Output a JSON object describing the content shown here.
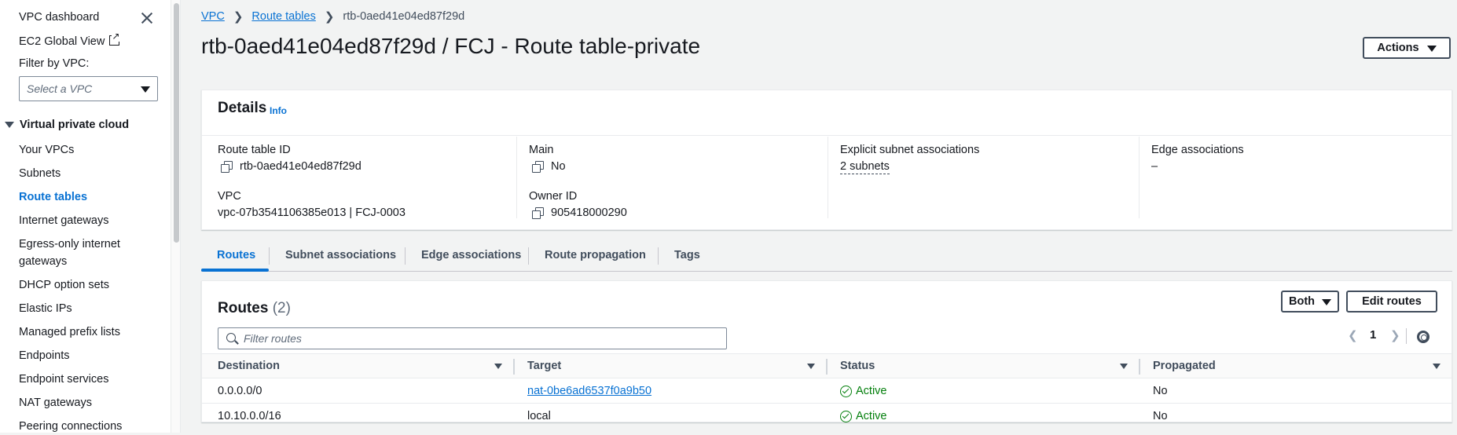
{
  "sidebar": {
    "dashboard_label": "VPC dashboard",
    "ec2_global_view": "EC2 Global View",
    "filter_label": "Filter by VPC:",
    "filter_placeholder": "Select a VPC",
    "section_title": "Virtual private cloud",
    "items": [
      {
        "label": "Your VPCs"
      },
      {
        "label": "Subnets"
      },
      {
        "label": "Route tables"
      },
      {
        "label": "Internet gateways"
      },
      {
        "label": "Egress-only internet"
      },
      {
        "label": "gateways"
      },
      {
        "label": "DHCP option sets"
      },
      {
        "label": "Elastic IPs"
      },
      {
        "label": "Managed prefix lists"
      },
      {
        "label": "Endpoints"
      },
      {
        "label": "Endpoint services"
      },
      {
        "label": "NAT gateways"
      },
      {
        "label": "Peering connections"
      }
    ],
    "active_item": "Route tables"
  },
  "breadcrumb": {
    "root": "VPC",
    "parent": "Route tables",
    "current": "rtb-0aed41e04ed87f29d"
  },
  "page": {
    "title": "rtb-0aed41e04ed87f29d / FCJ - Route table-private",
    "actions_label": "Actions"
  },
  "details": {
    "heading": "Details",
    "info": "Info",
    "route_table_id_label": "Route table ID",
    "route_table_id": "rtb-0aed41e04ed87f29d",
    "vpc_label": "VPC",
    "vpc_value": "vpc-07b3541106385e013 | FCJ-0003",
    "main_label": "Main",
    "main_value": "No",
    "owner_label": "Owner ID",
    "owner_value": "905418000290",
    "explicit_label": "Explicit subnet associations",
    "explicit_value": "2 subnets",
    "edge_label": "Edge associations",
    "edge_value": "–"
  },
  "tabs": [
    {
      "label": "Routes"
    },
    {
      "label": "Subnet associations"
    },
    {
      "label": "Edge associations"
    },
    {
      "label": "Route propagation"
    },
    {
      "label": "Tags"
    }
  ],
  "routes": {
    "heading": "Routes",
    "count": "(2)",
    "filter_placeholder": "Filter routes",
    "both_label": "Both",
    "edit_label": "Edit routes",
    "page_number": "1",
    "columns": [
      "Destination",
      "Target",
      "Status",
      "Propagated"
    ],
    "rows": [
      {
        "destination": "0.0.0.0/0",
        "target": "nat-0be6ad6537f0a9b50",
        "status": "Active",
        "propagated": "No"
      },
      {
        "destination": "10.10.0.0/16",
        "target": "local",
        "status": "Active",
        "propagated": "No"
      }
    ]
  },
  "colors": {
    "link": "#0972d3",
    "success": "#037f0c",
    "text": "#16191f",
    "background": "#f2f3f3"
  }
}
